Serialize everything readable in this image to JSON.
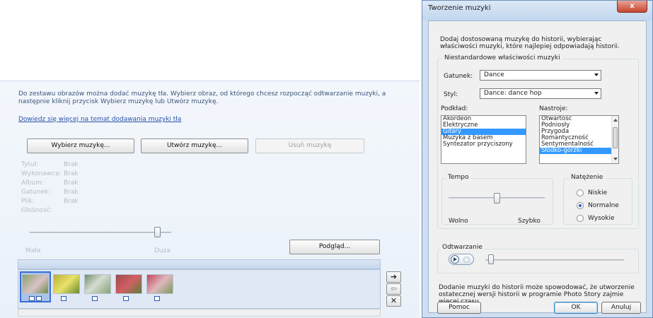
{
  "wizard": {
    "intro": "Do zestawu obrazów można dodać muzykę tła. Wybierz obraz, od którego chcesz rozpocząć odtwarzanie muzyki, a następnie kliknij przycisk Wybierz muzykę lub Utwórz muzykę.",
    "learn_more_link": "Dowiedz się więcej na temat dodawania muzyki tła",
    "buttons": {
      "choose_music": "Wybierz muzykę...",
      "create_music": "Utwórz muzykę...",
      "remove_music": "Usuń muzykę",
      "preview": "Podgląd..."
    },
    "meta": [
      {
        "label": "Tytuł:",
        "value": "Brak"
      },
      {
        "label": "Wykonawca:",
        "value": "Brak"
      },
      {
        "label": "Album:",
        "value": "Brak"
      },
      {
        "label": "Gatunek:",
        "value": "Brak"
      },
      {
        "label": "Plik:",
        "value": "Brak"
      }
    ],
    "volume_label": "Głośność:",
    "volume_level": 0.9,
    "volume_min_label": "Mała",
    "volume_max_label": "Duża",
    "filmstrip_thumbnails": [
      "photo-1",
      "photo-2",
      "photo-3",
      "photo-4",
      "photo-5"
    ],
    "side_buttons": {
      "right": "➔",
      "left": "⇦",
      "remove": "✕"
    }
  },
  "dialog": {
    "title": "Tworzenie muzyki",
    "close_glyph": "x",
    "description": "Dodaj dostosowaną muzykę do historii, wybierając właściwości muzyki, które najlepiej odpowiadają historii.",
    "group_title": "Niestandardowe właściwości muzyki",
    "genre_label": "Gatunek:",
    "genre_value": "Dance",
    "style_label": "Styl:",
    "style_value": "Dance: dance hop",
    "bands_label": "Podkład:",
    "bands": [
      "Akordeon",
      "Elektryczne",
      "Gitary",
      "Muzyka z basem",
      "Syntezator przyciszony"
    ],
    "bands_selected": 2,
    "moods_label": "Nastroje:",
    "moods": [
      "Otwartość",
      "Podniosły",
      "Przygoda",
      "Romantyczność",
      "Sentymentalność",
      "Słodko-gorzki"
    ],
    "moods_selected": 5,
    "tempo_label": "Tempo",
    "tempo_level": 0.5,
    "tempo_slow": "Wolno",
    "tempo_fast": "Szybko",
    "intensity_label": "Natężenie",
    "intensity_options": [
      "Niskie",
      "Normalne",
      "Wysokie"
    ],
    "intensity_selected": "Normalne",
    "playback_label": "Odtwarzanie",
    "note": "Dodanie muzyki do historii może spowodować, że utworzenie ostatecznej wersji historii w programie Photo Story zajmie więcej czasu.",
    "help_button": "Pomoc",
    "ok_button": "OK",
    "cancel_button": "Anuluj"
  }
}
